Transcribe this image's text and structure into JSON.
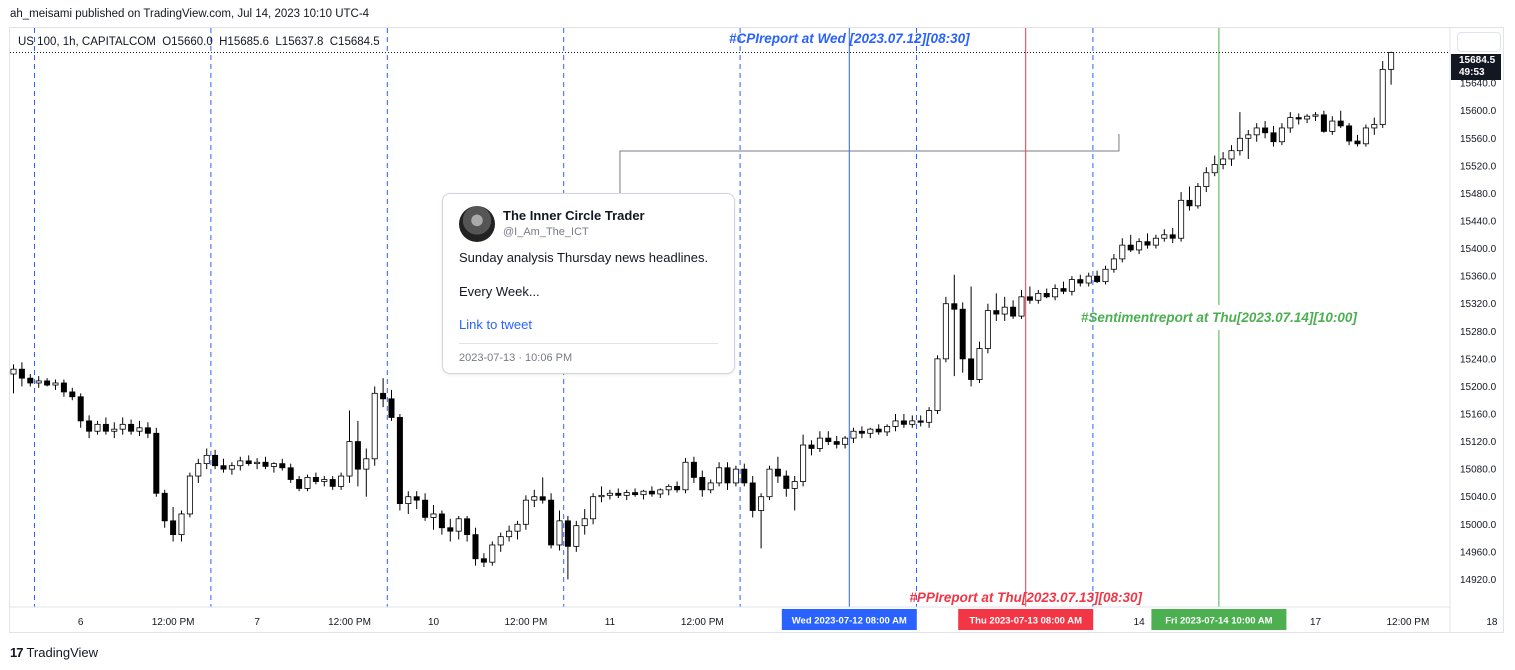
{
  "header": {
    "published_by": "ah_meisami published on TradingView.com, Jul 14, 2023 10:10 UTC-4"
  },
  "legend": {
    "text": "US 100, 1h, CAPITALCOM  O15660.0  H15685.6  L15637.8  C15684.5"
  },
  "tweet": {
    "name": "The Inner Circle Trader",
    "handle": "@I_Am_The_ICT",
    "line1": "Sunday analysis Thursday news headlines.",
    "line2": "Every Week...",
    "link": "Link to tweet",
    "date": "2023-07-13 · 10:06 PM"
  },
  "price_tag": {
    "price": "15684.5",
    "countdown": "49:53"
  },
  "footer": {
    "brand": "TradingView"
  },
  "colors": {
    "up": "#ffffff",
    "down": "#000000",
    "wick": "#000000",
    "cpi": "#2962ff",
    "ppi": "#f23645",
    "sentiment": "#4caf50",
    "session": "#2962ff"
  },
  "chart_data": {
    "type": "candlestick",
    "title": "US 100, 1h, CAPITALCOM",
    "ylim": [
      14880,
      15720
    ],
    "y_ticks": [
      14920,
      14960,
      15000,
      15040,
      15080,
      15120,
      15160,
      15200,
      15240,
      15280,
      15320,
      15360,
      15400,
      15440,
      15480,
      15520,
      15560,
      15600,
      15640
    ],
    "x_ticks": [
      {
        "i": 8,
        "label": "6"
      },
      {
        "i": 19,
        "label": "12:00 PM"
      },
      {
        "i": 29,
        "label": "7"
      },
      {
        "i": 40,
        "label": "12:00 PM"
      },
      {
        "i": 50,
        "label": "10"
      },
      {
        "i": 61,
        "label": "12:00 PM"
      },
      {
        "i": 71,
        "label": "11"
      },
      {
        "i": 82,
        "label": "12:00 PM"
      },
      {
        "i": 134,
        "label": "14"
      },
      {
        "i": 155,
        "label": "17"
      },
      {
        "i": 166,
        "label": "12:00 PM"
      },
      {
        "i": 176,
        "label": "18"
      }
    ],
    "session_lines": [
      2.5,
      23.5,
      44.5,
      65.5,
      86.5,
      107.5,
      128.5
    ],
    "events": [
      {
        "i": 99.5,
        "name": "#CPIreport at Wed [2023.07.12][08:30]",
        "badge": "Wed 2023-07-12   08:00 AM",
        "color": "cpi",
        "label_pos": "top"
      },
      {
        "i": 120.5,
        "name": "#PPIreport at Thu[2023.07.13][08:30]",
        "badge": "Thu 2023-07-13   08:00 AM",
        "color": "ppi",
        "label_pos": "bottom"
      },
      {
        "i": 143.5,
        "name": "#Sentimentreport at Thu[2023.07.14][10:00]",
        "badge": "Fri 2023-07-14   10:00 AM",
        "color": "sentiment",
        "label_pos": "middle"
      }
    ],
    "tweet_anchor": {
      "i_start": 72.2,
      "i_end": 131.6,
      "price": 15530
    },
    "last_price": 15684.5,
    "candles": [
      {
        "o": 15218,
        "h": 15232,
        "l": 15190,
        "c": 15225
      },
      {
        "o": 15225,
        "h": 15235,
        "l": 15200,
        "c": 15212
      },
      {
        "o": 15212,
        "h": 15218,
        "l": 15200,
        "c": 15205
      },
      {
        "o": 15205,
        "h": 15215,
        "l": 15198,
        "c": 15208
      },
      {
        "o": 15208,
        "h": 15212,
        "l": 15200,
        "c": 15202
      },
      {
        "o": 15202,
        "h": 15210,
        "l": 15195,
        "c": 15205
      },
      {
        "o": 15205,
        "h": 15210,
        "l": 15185,
        "c": 15192
      },
      {
        "o": 15192,
        "h": 15198,
        "l": 15180,
        "c": 15185
      },
      {
        "o": 15185,
        "h": 15190,
        "l": 15140,
        "c": 15150
      },
      {
        "o": 15150,
        "h": 15158,
        "l": 15125,
        "c": 15135
      },
      {
        "o": 15135,
        "h": 15150,
        "l": 15130,
        "c": 15145
      },
      {
        "o": 15145,
        "h": 15155,
        "l": 15130,
        "c": 15135
      },
      {
        "o": 15135,
        "h": 15148,
        "l": 15125,
        "c": 15138
      },
      {
        "o": 15138,
        "h": 15155,
        "l": 15130,
        "c": 15145
      },
      {
        "o": 15145,
        "h": 15152,
        "l": 15130,
        "c": 15135
      },
      {
        "o": 15135,
        "h": 15150,
        "l": 15128,
        "c": 15140
      },
      {
        "o": 15140,
        "h": 15148,
        "l": 15125,
        "c": 15132
      },
      {
        "o": 15132,
        "h": 15140,
        "l": 15040,
        "c": 15045
      },
      {
        "o": 15045,
        "h": 15050,
        "l": 14995,
        "c": 15005
      },
      {
        "o": 15005,
        "h": 15025,
        "l": 14975,
        "c": 14985
      },
      {
        "o": 14985,
        "h": 15020,
        "l": 14975,
        "c": 15015
      },
      {
        "o": 15015,
        "h": 15075,
        "l": 15010,
        "c": 15070
      },
      {
        "o": 15070,
        "h": 15095,
        "l": 15060,
        "c": 15088
      },
      {
        "o": 15088,
        "h": 15110,
        "l": 15080,
        "c": 15100
      },
      {
        "o": 15100,
        "h": 15108,
        "l": 15080,
        "c": 15085
      },
      {
        "o": 15085,
        "h": 15095,
        "l": 15075,
        "c": 15080
      },
      {
        "o": 15080,
        "h": 15090,
        "l": 15072,
        "c": 15085
      },
      {
        "o": 15085,
        "h": 15098,
        "l": 15078,
        "c": 15092
      },
      {
        "o": 15092,
        "h": 15100,
        "l": 15085,
        "c": 15088
      },
      {
        "o": 15088,
        "h": 15096,
        "l": 15080,
        "c": 15090
      },
      {
        "o": 15090,
        "h": 15098,
        "l": 15080,
        "c": 15084
      },
      {
        "o": 15084,
        "h": 15090,
        "l": 15075,
        "c": 15088
      },
      {
        "o": 15088,
        "h": 15095,
        "l": 15078,
        "c": 15082
      },
      {
        "o": 15082,
        "h": 15088,
        "l": 15060,
        "c": 15065
      },
      {
        "o": 15065,
        "h": 15070,
        "l": 15048,
        "c": 15052
      },
      {
        "o": 15052,
        "h": 15072,
        "l": 15048,
        "c": 15068
      },
      {
        "o": 15068,
        "h": 15075,
        "l": 15058,
        "c": 15062
      },
      {
        "o": 15062,
        "h": 15070,
        "l": 15055,
        "c": 15065
      },
      {
        "o": 15065,
        "h": 15070,
        "l": 15050,
        "c": 15055
      },
      {
        "o": 15055,
        "h": 15075,
        "l": 15050,
        "c": 15070
      },
      {
        "o": 15070,
        "h": 15165,
        "l": 15060,
        "c": 15120
      },
      {
        "o": 15120,
        "h": 15150,
        "l": 15055,
        "c": 15080
      },
      {
        "o": 15080,
        "h": 15110,
        "l": 15040,
        "c": 15095
      },
      {
        "o": 15095,
        "h": 15200,
        "l": 15085,
        "c": 15190
      },
      {
        "o": 15190,
        "h": 15212,
        "l": 15170,
        "c": 15182
      },
      {
        "o": 15182,
        "h": 15195,
        "l": 15150,
        "c": 15155
      },
      {
        "o": 15155,
        "h": 15160,
        "l": 15020,
        "c": 15030
      },
      {
        "o": 15030,
        "h": 15048,
        "l": 15015,
        "c": 15040
      },
      {
        "o": 15040,
        "h": 15048,
        "l": 15022,
        "c": 15035
      },
      {
        "o": 15035,
        "h": 15045,
        "l": 15005,
        "c": 15010
      },
      {
        "o": 15010,
        "h": 15028,
        "l": 14992,
        "c": 15015
      },
      {
        "o": 15015,
        "h": 15020,
        "l": 14985,
        "c": 14995
      },
      {
        "o": 14995,
        "h": 15008,
        "l": 14975,
        "c": 14990
      },
      {
        "o": 14990,
        "h": 15012,
        "l": 14978,
        "c": 15008
      },
      {
        "o": 15008,
        "h": 15012,
        "l": 14975,
        "c": 14985
      },
      {
        "o": 14985,
        "h": 14995,
        "l": 14940,
        "c": 14950
      },
      {
        "o": 14950,
        "h": 14958,
        "l": 14938,
        "c": 14945
      },
      {
        "o": 14945,
        "h": 14975,
        "l": 14940,
        "c": 14970
      },
      {
        "o": 14970,
        "h": 14988,
        "l": 14960,
        "c": 14982
      },
      {
        "o": 14982,
        "h": 14998,
        "l": 14975,
        "c": 14990
      },
      {
        "o": 14990,
        "h": 15005,
        "l": 14978,
        "c": 15000
      },
      {
        "o": 15000,
        "h": 15042,
        "l": 14992,
        "c": 15035
      },
      {
        "o": 15035,
        "h": 15050,
        "l": 15025,
        "c": 15040
      },
      {
        "o": 15040,
        "h": 15068,
        "l": 15030,
        "c": 15035
      },
      {
        "o": 15035,
        "h": 15045,
        "l": 14965,
        "c": 14970
      },
      {
        "o": 14970,
        "h": 15020,
        "l": 14962,
        "c": 15005
      },
      {
        "o": 15005,
        "h": 15012,
        "l": 14920,
        "c": 14968
      },
      {
        "o": 14968,
        "h": 15005,
        "l": 14960,
        "c": 14998
      },
      {
        "o": 14998,
        "h": 15022,
        "l": 14985,
        "c": 15008
      },
      {
        "o": 15008,
        "h": 15045,
        "l": 15000,
        "c": 15040
      },
      {
        "o": 15040,
        "h": 15055,
        "l": 15032,
        "c": 15042
      },
      {
        "o": 15042,
        "h": 15050,
        "l": 15036,
        "c": 15045
      },
      {
        "o": 15045,
        "h": 15052,
        "l": 15038,
        "c": 15042
      },
      {
        "o": 15042,
        "h": 15050,
        "l": 15035,
        "c": 15046
      },
      {
        "o": 15046,
        "h": 15052,
        "l": 15040,
        "c": 15043
      },
      {
        "o": 15043,
        "h": 15050,
        "l": 15036,
        "c": 15048
      },
      {
        "o": 15048,
        "h": 15055,
        "l": 15040,
        "c": 15044
      },
      {
        "o": 15044,
        "h": 15052,
        "l": 15038,
        "c": 15050
      },
      {
        "o": 15050,
        "h": 15058,
        "l": 15042,
        "c": 15055
      },
      {
        "o": 15055,
        "h": 15062,
        "l": 15046,
        "c": 15050
      },
      {
        "o": 15050,
        "h": 15096,
        "l": 15045,
        "c": 15090
      },
      {
        "o": 15090,
        "h": 15098,
        "l": 15060,
        "c": 15068
      },
      {
        "o": 15068,
        "h": 15078,
        "l": 15040,
        "c": 15050
      },
      {
        "o": 15050,
        "h": 15065,
        "l": 15045,
        "c": 15060
      },
      {
        "o": 15060,
        "h": 15090,
        "l": 15055,
        "c": 15082
      },
      {
        "o": 15082,
        "h": 15090,
        "l": 15050,
        "c": 15060
      },
      {
        "o": 15060,
        "h": 15085,
        "l": 15055,
        "c": 15080
      },
      {
        "o": 15080,
        "h": 15088,
        "l": 15055,
        "c": 15060
      },
      {
        "o": 15060,
        "h": 15070,
        "l": 15010,
        "c": 15020
      },
      {
        "o": 15020,
        "h": 15045,
        "l": 14965,
        "c": 15040
      },
      {
        "o": 15040,
        "h": 15085,
        "l": 15035,
        "c": 15080
      },
      {
        "o": 15080,
        "h": 15098,
        "l": 15060,
        "c": 15070
      },
      {
        "o": 15070,
        "h": 15078,
        "l": 15040,
        "c": 15052
      },
      {
        "o": 15052,
        "h": 15070,
        "l": 15020,
        "c": 15062
      },
      {
        "o": 15062,
        "h": 15130,
        "l": 15055,
        "c": 15115
      },
      {
        "o": 15115,
        "h": 15122,
        "l": 15100,
        "c": 15110
      },
      {
        "o": 15110,
        "h": 15135,
        "l": 15105,
        "c": 15125
      },
      {
        "o": 15125,
        "h": 15135,
        "l": 15115,
        "c": 15120
      },
      {
        "o": 15120,
        "h": 15128,
        "l": 15110,
        "c": 15116
      },
      {
        "o": 15116,
        "h": 15128,
        "l": 15110,
        "c": 15125
      },
      {
        "o": 15125,
        "h": 15140,
        "l": 15118,
        "c": 15135
      },
      {
        "o": 15135,
        "h": 15142,
        "l": 15125,
        "c": 15132
      },
      {
        "o": 15132,
        "h": 15140,
        "l": 15125,
        "c": 15138
      },
      {
        "o": 15138,
        "h": 15145,
        "l": 15130,
        "c": 15134
      },
      {
        "o": 15134,
        "h": 15145,
        "l": 15128,
        "c": 15142
      },
      {
        "o": 15142,
        "h": 15160,
        "l": 15135,
        "c": 15150
      },
      {
        "o": 15150,
        "h": 15160,
        "l": 15140,
        "c": 15145
      },
      {
        "o": 15145,
        "h": 15158,
        "l": 15140,
        "c": 15150
      },
      {
        "o": 15150,
        "h": 15158,
        "l": 15142,
        "c": 15148
      },
      {
        "o": 15148,
        "h": 15170,
        "l": 15140,
        "c": 15165
      },
      {
        "o": 15165,
        "h": 15245,
        "l": 15160,
        "c": 15240
      },
      {
        "o": 15240,
        "h": 15330,
        "l": 15235,
        "c": 15320
      },
      {
        "o": 15320,
        "h": 15362,
        "l": 15215,
        "c": 15312
      },
      {
        "o": 15312,
        "h": 15322,
        "l": 15220,
        "c": 15240
      },
      {
        "o": 15240,
        "h": 15345,
        "l": 15200,
        "c": 15210
      },
      {
        "o": 15210,
        "h": 15265,
        "l": 15205,
        "c": 15255
      },
      {
        "o": 15255,
        "h": 15320,
        "l": 15248,
        "c": 15310
      },
      {
        "o": 15310,
        "h": 15335,
        "l": 15295,
        "c": 15305
      },
      {
        "o": 15305,
        "h": 15330,
        "l": 15295,
        "c": 15315
      },
      {
        "o": 15315,
        "h": 15325,
        "l": 15298,
        "c": 15302
      },
      {
        "o": 15302,
        "h": 15340,
        "l": 15298,
        "c": 15330
      },
      {
        "o": 15330,
        "h": 15345,
        "l": 15320,
        "c": 15325
      },
      {
        "o": 15325,
        "h": 15340,
        "l": 15320,
        "c": 15335
      },
      {
        "o": 15335,
        "h": 15342,
        "l": 15328,
        "c": 15330
      },
      {
        "o": 15330,
        "h": 15348,
        "l": 15325,
        "c": 15342
      },
      {
        "o": 15342,
        "h": 15352,
        "l": 15334,
        "c": 15338
      },
      {
        "o": 15338,
        "h": 15360,
        "l": 15332,
        "c": 15355
      },
      {
        "o": 15355,
        "h": 15362,
        "l": 15345,
        "c": 15350
      },
      {
        "o": 15350,
        "h": 15365,
        "l": 15345,
        "c": 15360
      },
      {
        "o": 15360,
        "h": 15368,
        "l": 15350,
        "c": 15352
      },
      {
        "o": 15352,
        "h": 15375,
        "l": 15348,
        "c": 15370
      },
      {
        "o": 15370,
        "h": 15392,
        "l": 15365,
        "c": 15385
      },
      {
        "o": 15385,
        "h": 15415,
        "l": 15380,
        "c": 15405
      },
      {
        "o": 15405,
        "h": 15420,
        "l": 15395,
        "c": 15398
      },
      {
        "o": 15398,
        "h": 15415,
        "l": 15392,
        "c": 15410
      },
      {
        "o": 15410,
        "h": 15422,
        "l": 15400,
        "c": 15405
      },
      {
        "o": 15405,
        "h": 15420,
        "l": 15400,
        "c": 15415
      },
      {
        "o": 15415,
        "h": 15428,
        "l": 15410,
        "c": 15420
      },
      {
        "o": 15420,
        "h": 15430,
        "l": 15408,
        "c": 15415
      },
      {
        "o": 15415,
        "h": 15482,
        "l": 15410,
        "c": 15470
      },
      {
        "o": 15470,
        "h": 15490,
        "l": 15455,
        "c": 15462
      },
      {
        "o": 15462,
        "h": 15495,
        "l": 15458,
        "c": 15490
      },
      {
        "o": 15490,
        "h": 15518,
        "l": 15482,
        "c": 15510
      },
      {
        "o": 15510,
        "h": 15535,
        "l": 15505,
        "c": 15522
      },
      {
        "o": 15522,
        "h": 15540,
        "l": 15515,
        "c": 15530
      },
      {
        "o": 15530,
        "h": 15550,
        "l": 15520,
        "c": 15542
      },
      {
        "o": 15542,
        "h": 15598,
        "l": 15535,
        "c": 15560
      },
      {
        "o": 15560,
        "h": 15572,
        "l": 15530,
        "c": 15565
      },
      {
        "o": 15565,
        "h": 15582,
        "l": 15555,
        "c": 15575
      },
      {
        "o": 15575,
        "h": 15585,
        "l": 15560,
        "c": 15568
      },
      {
        "o": 15568,
        "h": 15578,
        "l": 15548,
        "c": 15555
      },
      {
        "o": 15555,
        "h": 15582,
        "l": 15550,
        "c": 15575
      },
      {
        "o": 15575,
        "h": 15598,
        "l": 15568,
        "c": 15590
      },
      {
        "o": 15590,
        "h": 15596,
        "l": 15580,
        "c": 15588
      },
      {
        "o": 15588,
        "h": 15595,
        "l": 15582,
        "c": 15592
      },
      {
        "o": 15592,
        "h": 15598,
        "l": 15585,
        "c": 15594
      },
      {
        "o": 15594,
        "h": 15600,
        "l": 15568,
        "c": 15570
      },
      {
        "o": 15570,
        "h": 15592,
        "l": 15565,
        "c": 15585
      },
      {
        "o": 15585,
        "h": 15600,
        "l": 15575,
        "c": 15578
      },
      {
        "o": 15578,
        "h": 15582,
        "l": 15550,
        "c": 15556
      },
      {
        "o": 15556,
        "h": 15565,
        "l": 15548,
        "c": 15552
      },
      {
        "o": 15552,
        "h": 15580,
        "l": 15548,
        "c": 15575
      },
      {
        "o": 15575,
        "h": 15590,
        "l": 15565,
        "c": 15580
      },
      {
        "o": 15580,
        "h": 15672,
        "l": 15575,
        "c": 15660
      },
      {
        "o": 15660,
        "h": 15685.6,
        "l": 15637.8,
        "c": 15684.5
      }
    ]
  }
}
